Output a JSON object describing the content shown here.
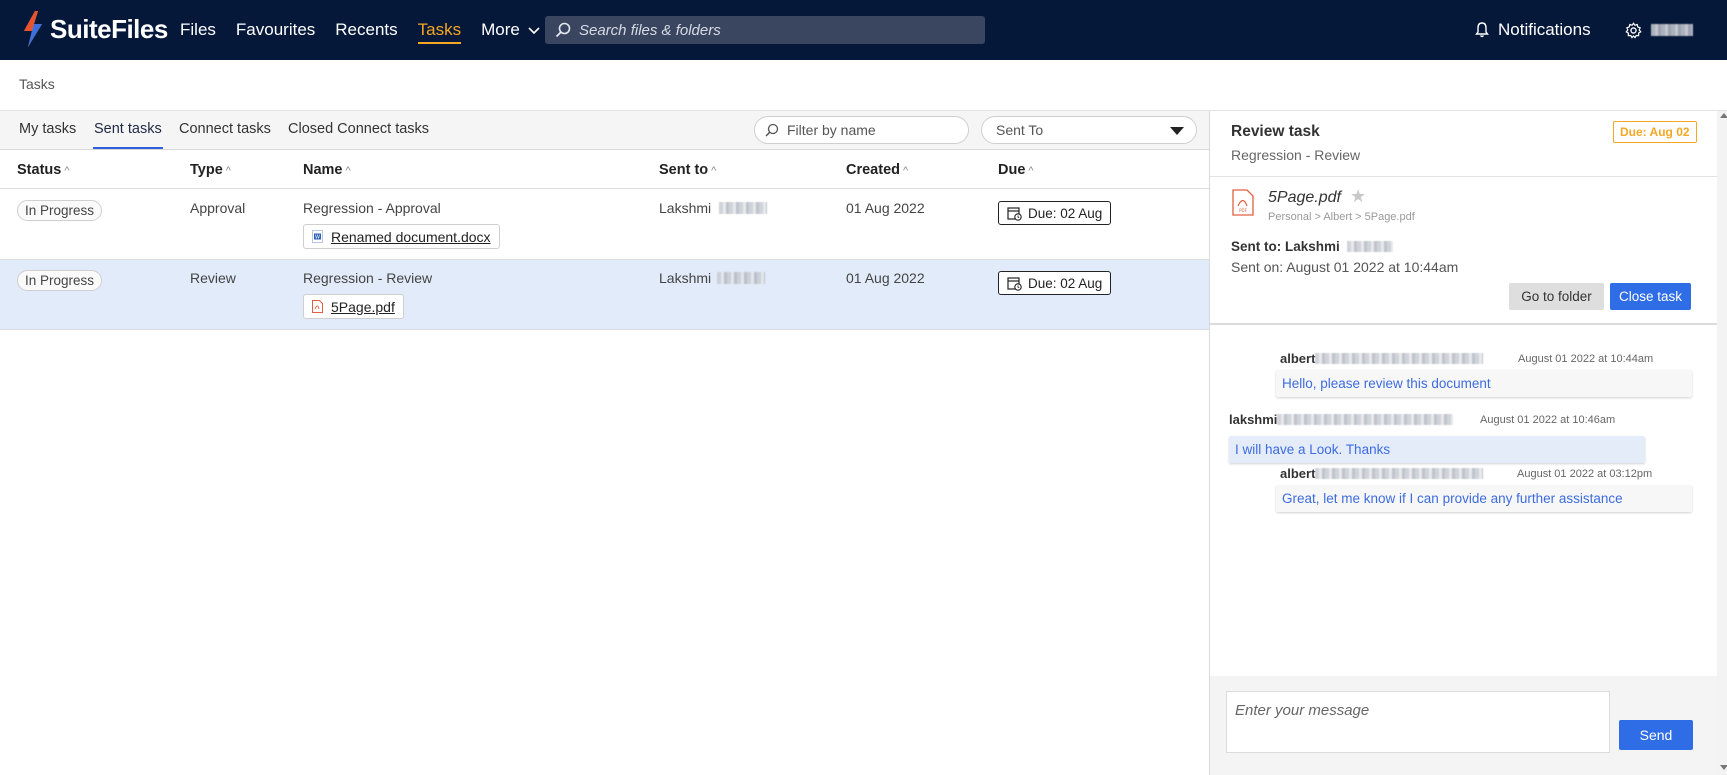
{
  "header": {
    "brand": "SuiteFiles",
    "nav": [
      {
        "label": "Files",
        "active": false
      },
      {
        "label": "Favourites",
        "active": false
      },
      {
        "label": "Recents",
        "active": false
      },
      {
        "label": "Tasks",
        "active": true
      },
      {
        "label": "More",
        "active": false
      }
    ],
    "search_placeholder": "Search files & folders",
    "notifications_label": "Notifications",
    "accent_color": "#f5a623",
    "bar_color": "#06183a"
  },
  "breadcrumb": "Tasks",
  "tabs": [
    {
      "label": "My tasks",
      "active": false
    },
    {
      "label": "Sent tasks",
      "active": true
    },
    {
      "label": "Connect tasks",
      "active": false
    },
    {
      "label": "Closed Connect tasks",
      "active": false
    }
  ],
  "filter": {
    "placeholder": "Filter by name",
    "sent_to_label": "Sent To"
  },
  "table": {
    "columns": [
      "Status",
      "Type",
      "Name",
      "Sent to",
      "Created",
      "Due"
    ],
    "rows": [
      {
        "status": "In Progress",
        "type": "Approval",
        "name": "Regression - Approval",
        "file": "Renamed document.docx",
        "file_icon": "word-doc-icon",
        "sent_to": "Lakshmi",
        "created": "01 Aug 2022",
        "due": "Due: 02 Aug",
        "selected": false
      },
      {
        "status": "In Progress",
        "type": "Review",
        "name": "Regression - Review",
        "file": "5Page.pdf",
        "file_icon": "pdf-icon",
        "sent_to": "Lakshmi",
        "created": "01 Aug 2022",
        "due": "Due: 02 Aug",
        "selected": true
      }
    ]
  },
  "panel": {
    "title": "Review task",
    "subtitle": "Regression - Review",
    "due_badge": "Due: Aug 02",
    "file_name": "5Page.pdf",
    "file_path": "Personal > Albert > 5Page.pdf",
    "sent_to": "Sent to: Lakshmi",
    "sent_on": "Sent on: August 01 2022 at 10:44am",
    "go_to_folder": "Go to folder",
    "close_task": "Close task",
    "messages": [
      {
        "author": "albert",
        "time": "August 01 2022 at 10:44am",
        "text": "Hello, please review this document"
      },
      {
        "author": "lakshmi",
        "time": "August 01 2022 at 10:46am",
        "text": "I will have a Look. Thanks"
      },
      {
        "author": "albert",
        "time": "August 01 2022 at 03:12pm",
        "text": "Great, let me know if I can provide any further assistance"
      }
    ],
    "message_placeholder": "Enter your message",
    "send_label": "Send"
  }
}
